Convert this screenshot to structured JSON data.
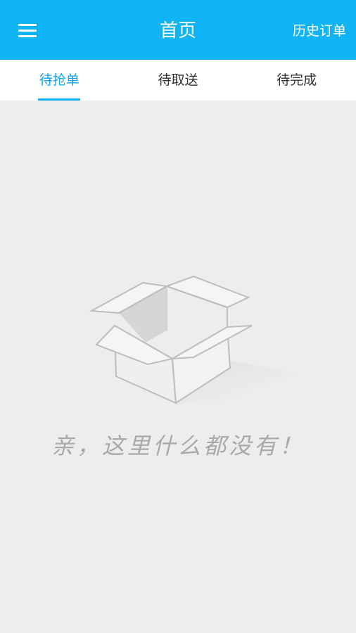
{
  "header": {
    "title": "首页",
    "right_link": "历史订单",
    "menu_icon": "hamburger-menu-icon",
    "bg_color": "#10b4f5"
  },
  "tabs": [
    {
      "label": "待抢单",
      "active": true
    },
    {
      "label": "待取送",
      "active": false
    },
    {
      "label": "待完成",
      "active": false
    }
  ],
  "empty_state": {
    "icon": "empty-box-icon",
    "message": "亲，这里什么都没有！"
  }
}
